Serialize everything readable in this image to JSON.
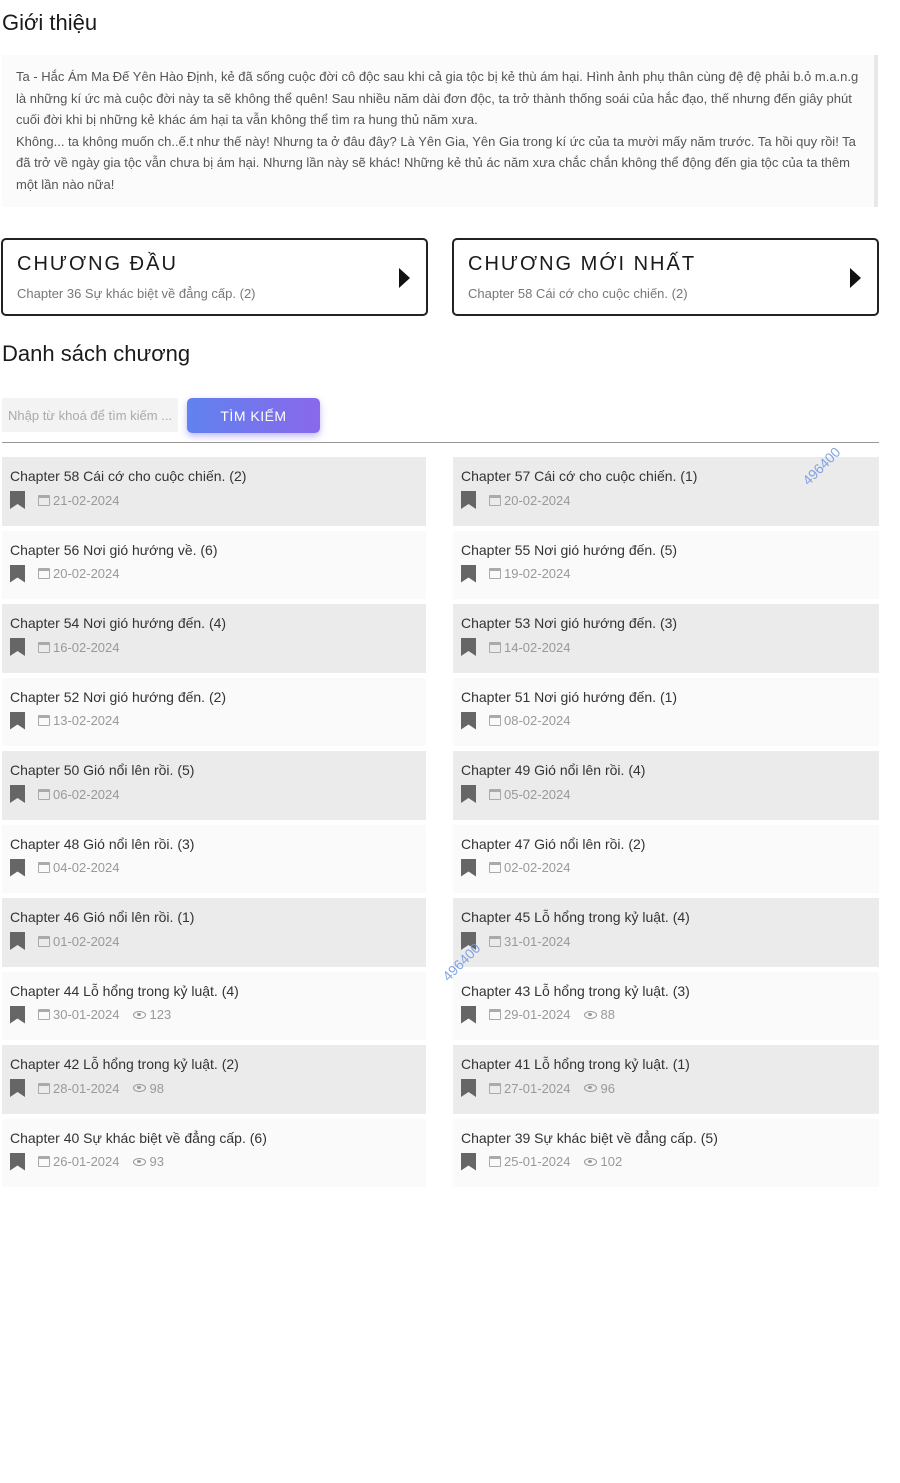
{
  "intro": {
    "title": "Giới thiệu",
    "paragraphs": [
      "Ta - Hắc Ám Ma Đế Yên Hào Định, kẻ đã sống cuộc đời cô độc sau khi cả gia tộc bị kẻ thù ám hại. Hình ảnh phụ thân cùng đệ đệ phải b.ỏ m.a.n.g là những kí ức mà cuộc đời này ta sẽ không thể quên! Sau nhiều năm dài đơn độc, ta trở thành thống soái của hắc đạo, thế nhưng đến giây phút cuối đời khi bị những kẻ khác ám hại ta vẫn không thể tìm ra hung thủ năm xưa.",
      "Không... ta không muốn ch..ế.t như thế này! Nhưng ta ở đâu đây? Là Yên Gia, Yên Gia trong kí ức của ta mười mấy năm trước. Ta hồi quy rồi! Ta đã trở về ngày gia tộc vẫn chưa bị ám hại. Nhưng lần này sẽ khác! Những kẻ thủ ác năm xưa chắc chắn không thể động đến gia tộc của ta thêm một lần nào nữa!"
    ]
  },
  "nav": {
    "first": {
      "title": "CHƯƠNG ĐẦU",
      "subtitle": "Chapter 36 Sự khác biệt về đẳng cấp. (2)"
    },
    "latest": {
      "title": "CHƯƠNG MỚI NHẤT",
      "subtitle": "Chapter 58 Cái cớ cho cuộc chiến. (2)"
    }
  },
  "chapter_list": {
    "title": "Danh sách chương",
    "search_placeholder": "Nhập từ khoá để tìm kiếm ...",
    "search_button": "TÌM KIẾM",
    "items": [
      {
        "title": "Chapter 58 Cái cớ cho cuộc chiến. (2)",
        "date": "21-02-2024",
        "views": ""
      },
      {
        "title": "Chapter 57 Cái cớ cho cuộc chiến. (1)",
        "date": "20-02-2024",
        "views": ""
      },
      {
        "title": "Chapter 56 Nơi gió hướng về. (6)",
        "date": "20-02-2024",
        "views": ""
      },
      {
        "title": "Chapter 55 Nơi gió hướng đến. (5)",
        "date": "19-02-2024",
        "views": ""
      },
      {
        "title": "Chapter 54 Nơi gió hướng đến. (4)",
        "date": "16-02-2024",
        "views": ""
      },
      {
        "title": "Chapter 53 Nơi gió hướng đến. (3)",
        "date": "14-02-2024",
        "views": ""
      },
      {
        "title": "Chapter 52 Nơi gió hướng đến. (2)",
        "date": "13-02-2024",
        "views": ""
      },
      {
        "title": "Chapter 51 Nơi gió hướng đến. (1)",
        "date": "08-02-2024",
        "views": ""
      },
      {
        "title": "Chapter 50 Gió nổi lên rồi. (5)",
        "date": "06-02-2024",
        "views": ""
      },
      {
        "title": "Chapter 49 Gió nổi lên rồi. (4)",
        "date": "05-02-2024",
        "views": ""
      },
      {
        "title": "Chapter 48 Gió nổi lên rồi. (3)",
        "date": "04-02-2024",
        "views": ""
      },
      {
        "title": "Chapter 47 Gió nổi lên rồi. (2)",
        "date": "02-02-2024",
        "views": ""
      },
      {
        "title": "Chapter 46 Gió nổi lên rồi. (1)",
        "date": "01-02-2024",
        "views": ""
      },
      {
        "title": "Chapter 45 Lỗ hổng trong kỷ luật. (4)",
        "date": "31-01-2024",
        "views": ""
      },
      {
        "title": "Chapter 44 Lỗ hổng trong kỷ luật. (4)",
        "date": "30-01-2024",
        "views": "123"
      },
      {
        "title": "Chapter 43 Lỗ hổng trong kỷ luật. (3)",
        "date": "29-01-2024",
        "views": "88"
      },
      {
        "title": "Chapter 42 Lỗ hổng trong kỷ luật. (2)",
        "date": "28-01-2024",
        "views": "98"
      },
      {
        "title": "Chapter 41 Lỗ hổng trong kỷ luật. (1)",
        "date": "27-01-2024",
        "views": "96"
      },
      {
        "title": "Chapter 40 Sự khác biệt về đẳng cấp. (6)",
        "date": "26-01-2024",
        "views": "93"
      },
      {
        "title": "Chapter 39 Sự khác biệt về đẳng cấp. (5)",
        "date": "25-01-2024",
        "views": "102"
      }
    ]
  },
  "watermark": "496400",
  "icons": {
    "nav_arrow": "caret-right-icon",
    "bookmark": "bookmark-icon",
    "date": "calendar-icon",
    "views": "eye-icon"
  },
  "colors": {
    "button_gradient_start": "#5f82ee",
    "button_gradient_end": "#8a68ec",
    "row_shade": "#ebebeb",
    "watermark": "#6f95e0"
  }
}
